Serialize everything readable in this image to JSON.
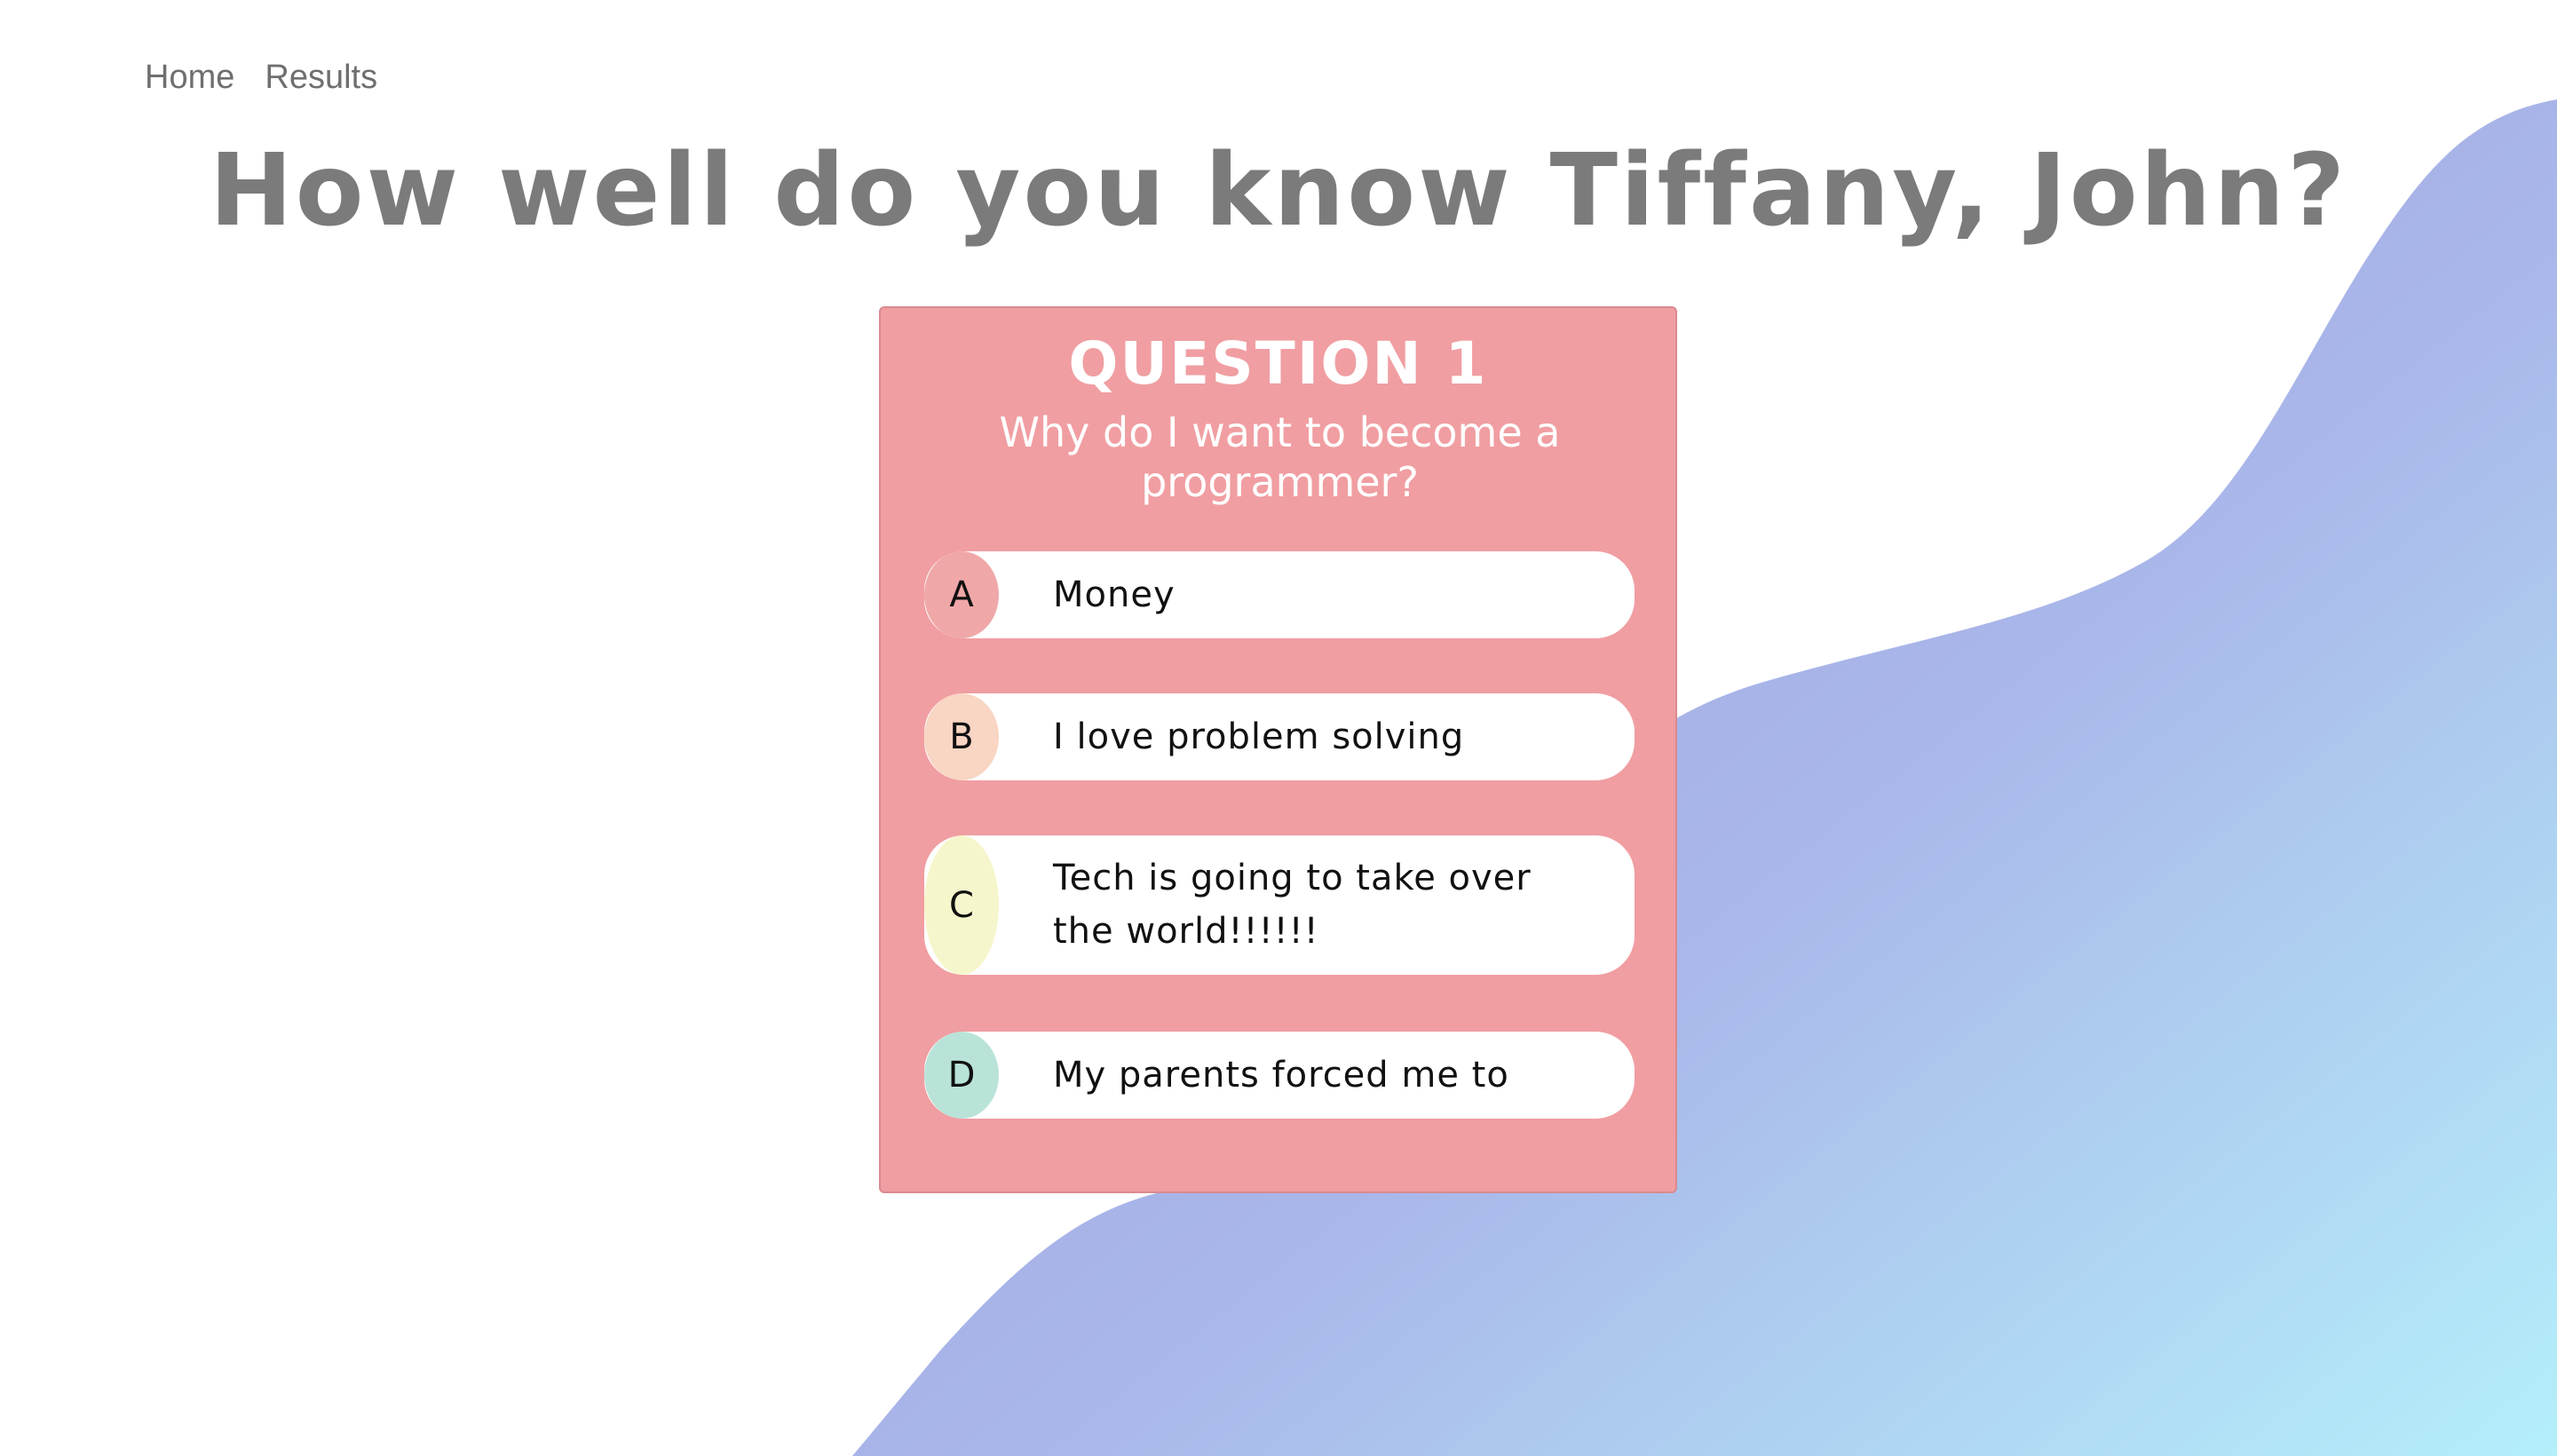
{
  "nav": {
    "home": "Home",
    "results": "Results"
  },
  "title": "How well do you know Tiffany, John?",
  "question": {
    "number_label": "QUESTION 1",
    "text": "Why do I want to become a programmer?",
    "answers": [
      {
        "letter": "A",
        "text": "Money",
        "color": "#f0a7a8"
      },
      {
        "letter": "B",
        "text": "I love problem solving",
        "color": "#f9d5c3"
      },
      {
        "letter": "C",
        "text": "Tech is going to take over the world!!!!!!",
        "color": "#f6f6cc"
      },
      {
        "letter": "D",
        "text": "My parents forced me to",
        "color": "#b9e3d8"
      }
    ]
  },
  "colors": {
    "card": "#f09ea2",
    "blob_start": "#a4a6e3",
    "blob_end": "#b4effa",
    "title": "#7b7b7b"
  }
}
